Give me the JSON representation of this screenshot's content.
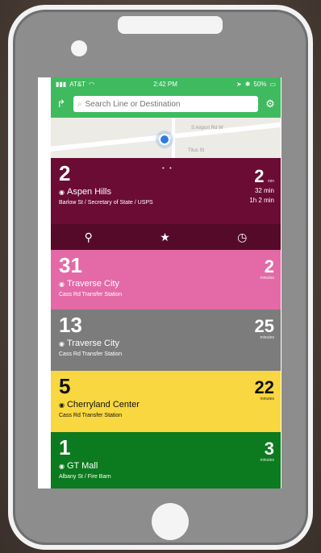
{
  "status_bar": {
    "carrier": "AT&T",
    "time": "2:42 PM",
    "battery": "50%"
  },
  "search": {
    "placeholder": "Search Line or Destination"
  },
  "map": {
    "labels": [
      "S Airport Rd W",
      "Titus St"
    ]
  },
  "routes": [
    {
      "number": "2",
      "destination": "Aspen Hills",
      "stop": "Barlow St / Secretary of State / USPS",
      "minutes": "2",
      "unit": "min",
      "next": [
        "32 min",
        "1h 2 min"
      ],
      "color": "#6a0c34"
    },
    {
      "number": "31",
      "destination": "Traverse City",
      "stop": "Cass Rd Transfer Station",
      "minutes": "2",
      "unit": "minutes",
      "color": "#e36aa6"
    },
    {
      "number": "13",
      "destination": "Traverse City",
      "stop": "Cass Rd Transfer Station",
      "minutes": "25",
      "unit": "minutes",
      "color": "#7c7c7c"
    },
    {
      "number": "5",
      "destination": "Cherryland Center",
      "stop": "Cass Rd Transfer Station",
      "minutes": "22",
      "unit": "minutes",
      "color": "#f9d740"
    },
    {
      "number": "1",
      "destination": "GT Mall",
      "stop": "Albany St / Fire Barn",
      "minutes": "3",
      "unit": "minutes",
      "color": "#0c7a1e"
    }
  ],
  "actions": [
    "location-pin-icon",
    "star-icon",
    "clock-icon"
  ]
}
